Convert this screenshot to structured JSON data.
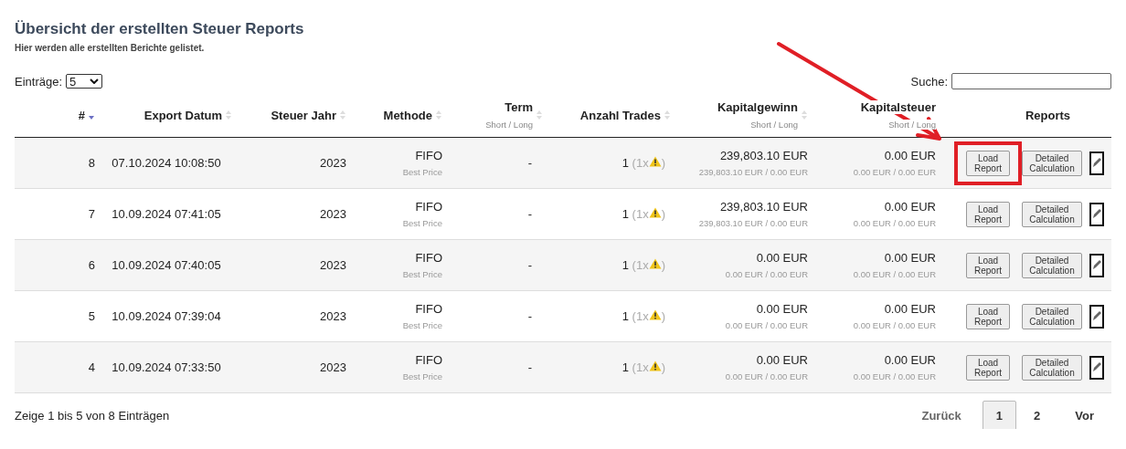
{
  "title": "Übersicht der erstellten Steuer Reports",
  "subtitle": "Hier werden alle erstellten Berichte gelistet.",
  "entries": {
    "label": "Einträge:",
    "value": "5"
  },
  "search": {
    "label": "Suche:"
  },
  "callout_arrow": true,
  "columns": [
    {
      "label": "#",
      "sortable": true,
      "sorted_desc": true
    },
    {
      "label": "Export Datum",
      "sortable": true,
      "sorted_desc": false
    },
    {
      "label": "Steuer Jahr",
      "sortable": true,
      "sorted_desc": false
    },
    {
      "label": "Methode",
      "sortable": true,
      "sorted_desc": false
    },
    {
      "label": "Term",
      "sub": "Short / Long",
      "sortable": true,
      "sorted_desc": false
    },
    {
      "label": "Anzahl Trades",
      "sortable": true,
      "sorted_desc": false
    },
    {
      "label": "Kapitalgewinn",
      "sub": "Short / Long",
      "sortable": true,
      "sorted_desc": false
    },
    {
      "label": "Kapitalsteuer",
      "sub": "Short / Long"
    },
    {
      "label": "Reports"
    }
  ],
  "rows": [
    {
      "id": "8",
      "date": "07.10.2024 10:08:50",
      "year": "2023",
      "method": "FIFO",
      "method_sub": "Best Price",
      "term": "-",
      "trades": "1",
      "warn_open": "(1x",
      "warn_close": ")",
      "gain": "239,803.10 EUR",
      "gain_sub": "239,803.10 EUR / 0.00 EUR",
      "tax": "0.00 EUR",
      "tax_sub": "0.00 EUR / 0.00 EUR",
      "load": "Load Report",
      "detail": "Detailed Calculation",
      "highlighted": true
    },
    {
      "id": "7",
      "date": "10.09.2024 07:41:05",
      "year": "2023",
      "method": "FIFO",
      "method_sub": "Best Price",
      "term": "-",
      "trades": "1",
      "warn_open": "(1x",
      "warn_close": ")",
      "gain": "239,803.10 EUR",
      "gain_sub": "239,803.10 EUR / 0.00 EUR",
      "tax": "0.00 EUR",
      "tax_sub": "0.00 EUR / 0.00 EUR",
      "load": "Load Report",
      "detail": "Detailed Calculation",
      "highlighted": false
    },
    {
      "id": "6",
      "date": "10.09.2024 07:40:05",
      "year": "2023",
      "method": "FIFO",
      "method_sub": "Best Price",
      "term": "-",
      "trades": "1",
      "warn_open": "(1x",
      "warn_close": ")",
      "gain": "0.00 EUR",
      "gain_sub": "0.00 EUR / 0.00 EUR",
      "tax": "0.00 EUR",
      "tax_sub": "0.00 EUR / 0.00 EUR",
      "load": "Load Report",
      "detail": "Detailed Calculation",
      "highlighted": false
    },
    {
      "id": "5",
      "date": "10.09.2024 07:39:04",
      "year": "2023",
      "method": "FIFO",
      "method_sub": "Best Price",
      "term": "-",
      "trades": "1",
      "warn_open": "(1x",
      "warn_close": ")",
      "gain": "0.00 EUR",
      "gain_sub": "0.00 EUR / 0.00 EUR",
      "tax": "0.00 EUR",
      "tax_sub": "0.00 EUR / 0.00 EUR",
      "load": "Load Report",
      "detail": "Detailed Calculation",
      "highlighted": false
    },
    {
      "id": "4",
      "date": "10.09.2024 07:33:50",
      "year": "2023",
      "method": "FIFO",
      "method_sub": "Best Price",
      "term": "-",
      "trades": "1",
      "warn_open": "(1x",
      "warn_close": ")",
      "gain": "0.00 EUR",
      "gain_sub": "0.00 EUR / 0.00 EUR",
      "tax": "0.00 EUR",
      "tax_sub": "0.00 EUR / 0.00 EUR",
      "load": "Load Report",
      "detail": "Detailed Calculation",
      "highlighted": false
    }
  ],
  "info": "Zeige 1 bis 5 von 8 Einträgen",
  "pagination": [
    {
      "label": "Zurück",
      "kind": "prev",
      "disabled": true,
      "selected": false
    },
    {
      "label": "1",
      "kind": "page",
      "disabled": false,
      "selected": true
    },
    {
      "label": "2",
      "kind": "page",
      "disabled": false,
      "selected": false
    },
    {
      "label": "Vor",
      "kind": "next",
      "disabled": false,
      "selected": false
    }
  ]
}
